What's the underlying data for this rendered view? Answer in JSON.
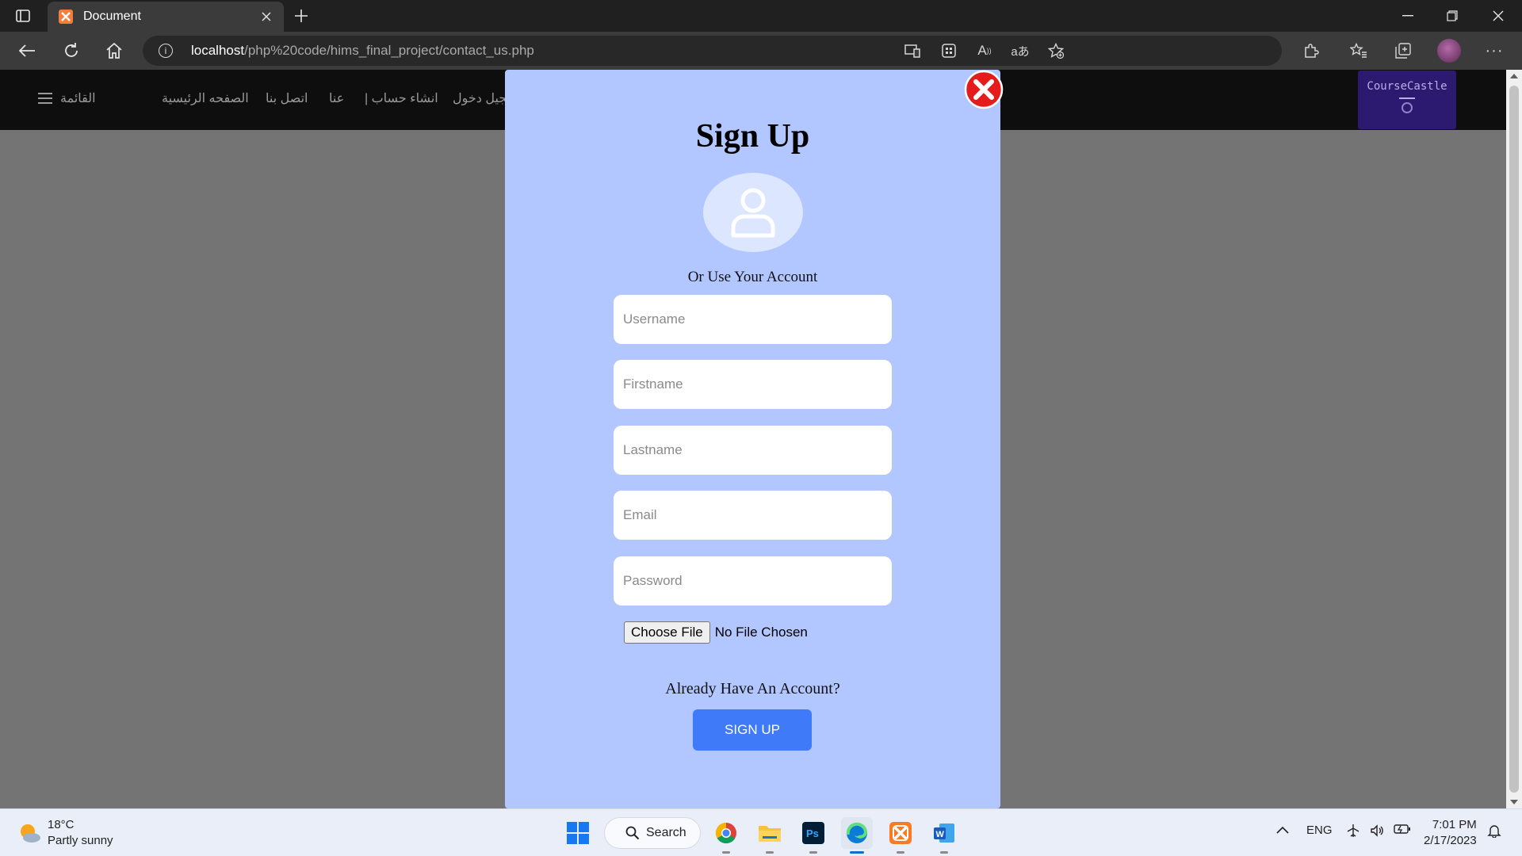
{
  "browser": {
    "tab_title": "Document",
    "url_host": "localhost",
    "url_path": "/php%20code/hims_final_project/contact_us.php"
  },
  "site": {
    "menu_label": "القائمة",
    "nav": [
      "الصفحه الرئيسية",
      "اتصل بنا",
      "عنا",
      "انشاء حساب |",
      "تسجيل دخول"
    ],
    "logo_text": "CourseCastle"
  },
  "modal": {
    "title": "Sign Up",
    "subtitle": "Or Use Your Account",
    "fields": {
      "username": "Username",
      "firstname": "Firstname",
      "lastname": "Lastname",
      "email": "Email",
      "password": "Password"
    },
    "choose_file_label": "Choose File",
    "file_status": "No File Chosen",
    "already_text": "Already Have An Account?",
    "signup_label": "SIGN UP"
  },
  "taskbar": {
    "weather_temp": "18°C",
    "weather_desc": "Partly sunny",
    "search_label": "Search",
    "language": "ENG",
    "time": "7:01 PM",
    "date": "2/17/2023"
  },
  "colors": {
    "modal_bg": "#b2c6ff",
    "signup_button": "#3f7bf8",
    "close_red": "#e51c1c",
    "logo_bg": "#2b1a70"
  }
}
